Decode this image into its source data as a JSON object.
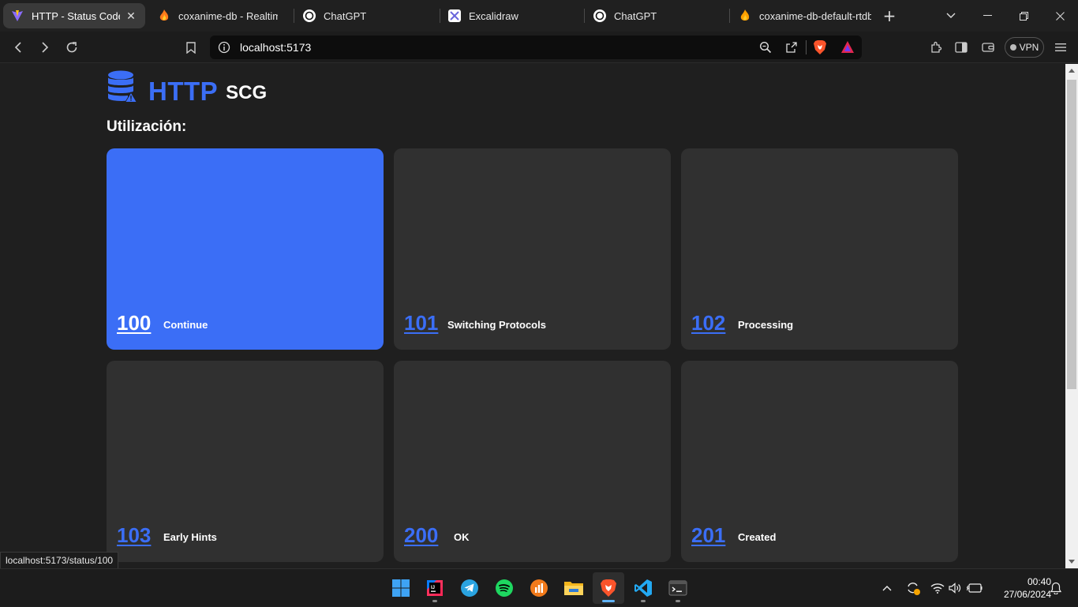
{
  "browser": {
    "tabs": [
      {
        "title": "HTTP - Status Code Generator",
        "favicon": "vite-icon",
        "active": true
      },
      {
        "title": "coxanime-db - Realtime Database",
        "favicon": "firebase-flame-icon",
        "active": false
      },
      {
        "title": "ChatGPT",
        "favicon": "chatgpt-icon",
        "active": false
      },
      {
        "title": "Excalidraw",
        "favicon": "excalidraw-icon",
        "active": false
      },
      {
        "title": "ChatGPT",
        "favicon": "chatgpt-icon",
        "active": false
      },
      {
        "title": "coxanime-db-default-rtdb",
        "favicon": "firebase-flame-icon",
        "active": false
      }
    ],
    "address": "localhost:5173",
    "vpn_label": "VPN",
    "hover_link": "localhost:5173/status/100"
  },
  "page": {
    "brand_primary": "HTTP",
    "brand_secondary": "SCG",
    "section_title": "Utilización:",
    "cards": [
      {
        "code": "100",
        "label": "Continue",
        "active": true
      },
      {
        "code": "101",
        "label": "Switching Protocols",
        "active": false
      },
      {
        "code": "102",
        "label": "Processing",
        "active": false
      },
      {
        "code": "103",
        "label": "Early Hints",
        "active": false
      },
      {
        "code": "200",
        "label": "OK",
        "active": false
      },
      {
        "code": "201",
        "label": "Created",
        "active": false
      }
    ],
    "colors": {
      "accent": "#3b6ef6",
      "card": "#303030",
      "background": "#1f1f1f"
    }
  },
  "taskbar": {
    "apps": [
      "windows-start-icon",
      "intellij-icon",
      "telegram-icon",
      "spotify-icon",
      "analytics-icon",
      "file-explorer-icon",
      "brave-icon",
      "vscode-icon",
      "terminal-icon"
    ],
    "time": "00:40",
    "date": "27/06/2024"
  }
}
